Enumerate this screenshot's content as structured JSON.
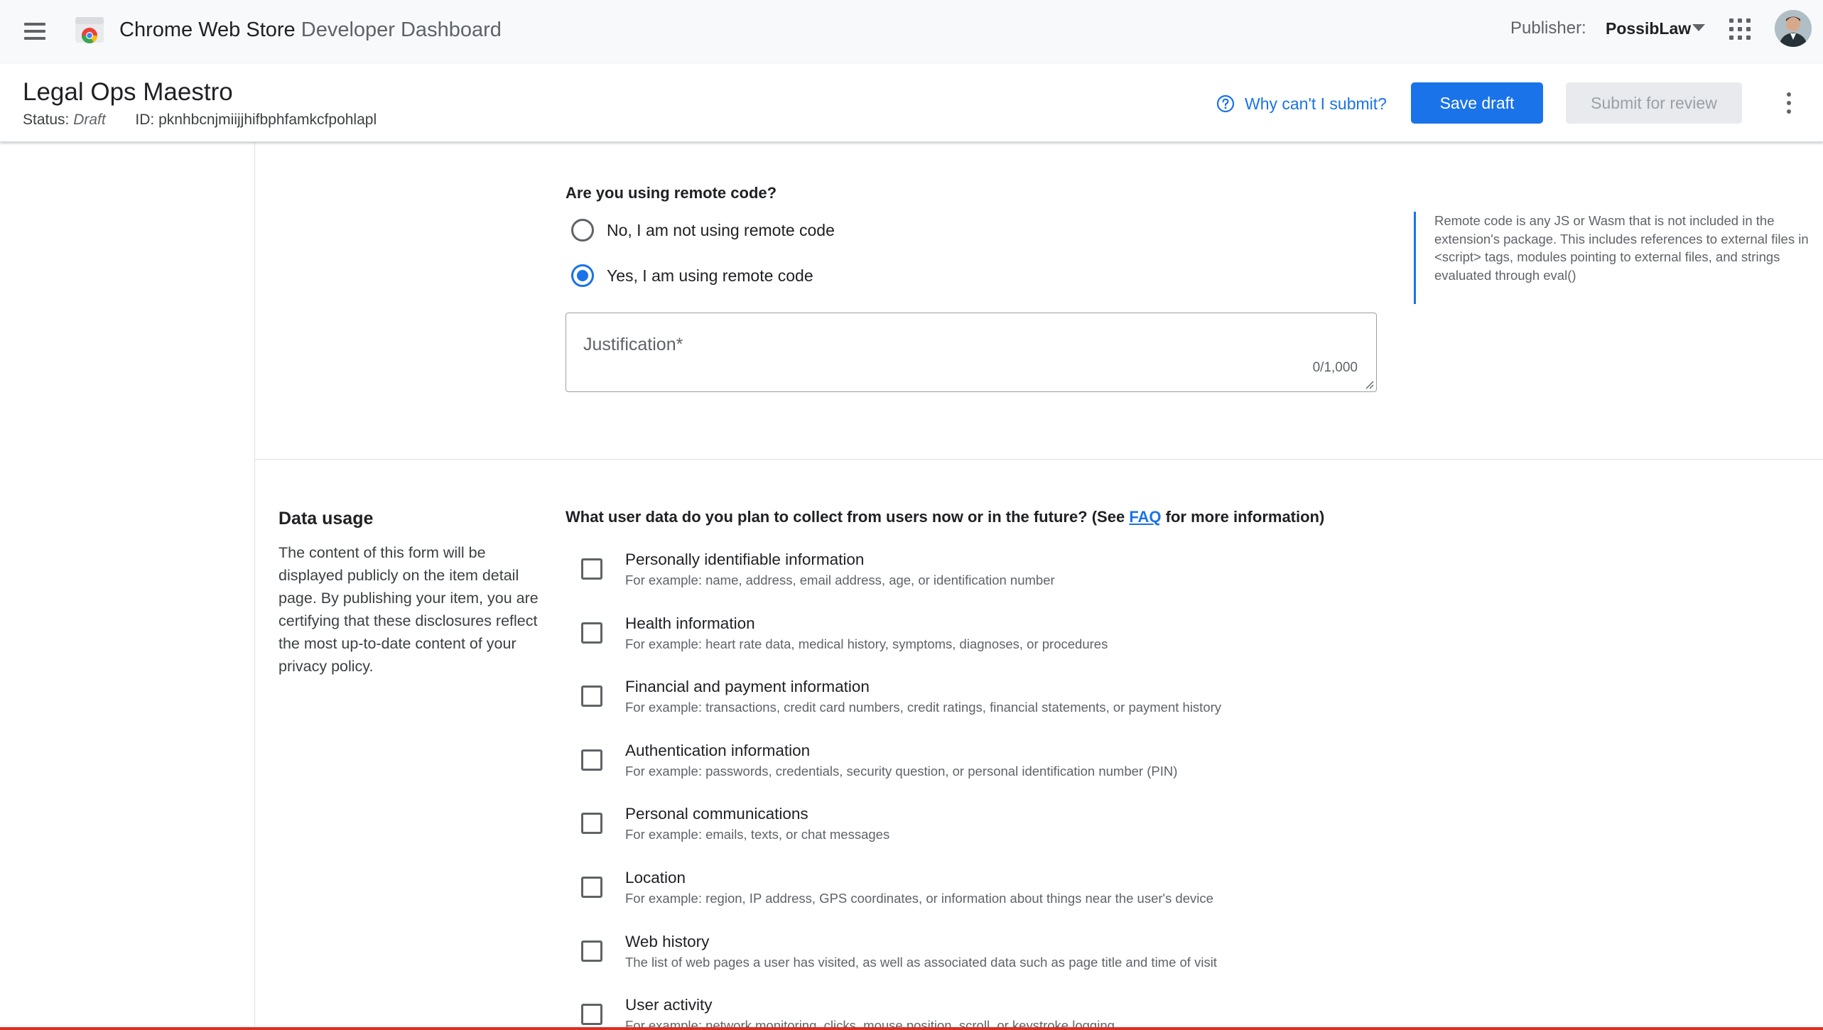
{
  "topbar": {
    "app_title_strong": "Chrome Web Store",
    "app_title_light": "Developer Dashboard",
    "publisher_label": "Publisher:",
    "publisher_name": "PossibLaw"
  },
  "item": {
    "name": "Legal Ops Maestro",
    "status_label": "Status:",
    "status_value": "Draft",
    "id_label": "ID:",
    "id_value": "pknhbcnjmiijjhifbphfamkcfpohlapl",
    "why_link": "Why can't I submit?",
    "save_draft": "Save draft",
    "submit_review": "Submit for review"
  },
  "remote_code": {
    "question": "Are you using remote code?",
    "options": [
      {
        "label": "No, I am not using remote code",
        "checked": false
      },
      {
        "label": "Yes, I am using remote code",
        "checked": true
      }
    ],
    "justification_placeholder": "Justification*",
    "justification_counter": "0/1,000",
    "side_note": "Remote code is any JS or Wasm that is not included in the extension's package. This includes references to external files in <script> tags, modules pointing to external files, and strings evaluated through eval()"
  },
  "data_usage": {
    "title": "Data usage",
    "description": "The content of this form will be displayed publicly on the item detail page. By publishing your item, you are certifying that these disclosures reflect the most up-to-date content of your privacy policy.",
    "question_prefix": "What user data do you plan to collect from users now or in the future? (See ",
    "question_link": "FAQ",
    "question_suffix": " for more information)",
    "items": [
      {
        "title": "Personally identifiable information",
        "sub": "For example: name, address, email address, age, or identification number"
      },
      {
        "title": "Health information",
        "sub": "For example: heart rate data, medical history, symptoms, diagnoses, or procedures"
      },
      {
        "title": "Financial and payment information",
        "sub": "For example: transactions, credit card numbers, credit ratings, financial statements, or payment history"
      },
      {
        "title": "Authentication information",
        "sub": "For example: passwords, credentials, security question, or personal identification number (PIN)"
      },
      {
        "title": "Personal communications",
        "sub": "For example: emails, texts, or chat messages"
      },
      {
        "title": "Location",
        "sub": "For example: region, IP address, GPS coordinates, or information about things near the user's device"
      },
      {
        "title": "Web history",
        "sub": "The list of web pages a user has visited, as well as associated data such as page title and time of visit"
      },
      {
        "title": "User activity",
        "sub": "For example: network monitoring, clicks, mouse position, scroll, or keystroke logging"
      }
    ]
  },
  "colors": {
    "accent": "#1a73e8",
    "disabled_bg": "#e8eaed",
    "disabled_text": "#9aa0a6"
  },
  "icons": [
    "menu-icon",
    "chrome-web-store-logo",
    "caret-down-icon",
    "apps-grid-icon",
    "help-circle-icon",
    "more-vert-icon",
    "resize-handle-icon"
  ]
}
